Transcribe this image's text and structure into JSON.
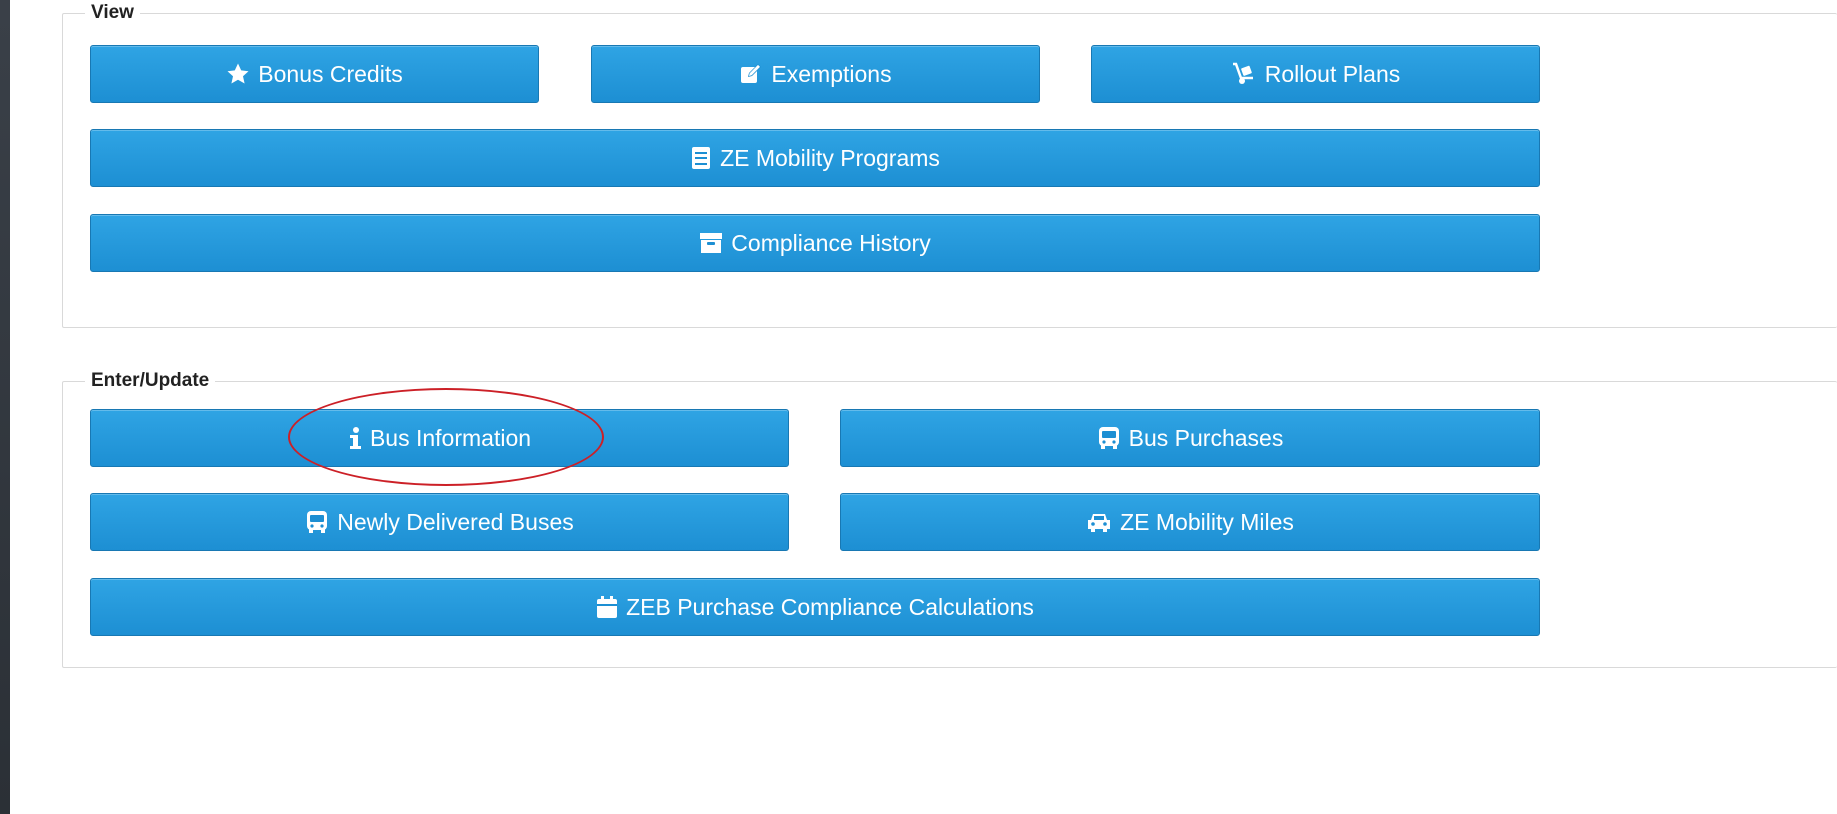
{
  "view": {
    "legend": "View",
    "buttons": {
      "bonus_credits": {
        "label": "Bonus Credits",
        "icon": "star-icon"
      },
      "exemptions": {
        "label": "Exemptions",
        "icon": "edit-icon"
      },
      "rollout_plans": {
        "label": "Rollout Plans",
        "icon": "dolly-icon"
      },
      "ze_mobility_programs": {
        "label": "ZE Mobility Programs",
        "icon": "book-icon"
      },
      "compliance_history": {
        "label": "Compliance History",
        "icon": "archive-icon"
      }
    }
  },
  "enter_update": {
    "legend": "Enter/Update",
    "buttons": {
      "bus_information": {
        "label": "Bus Information",
        "icon": "info-icon"
      },
      "bus_purchases": {
        "label": "Bus Purchases",
        "icon": "bus-icon"
      },
      "newly_delivered_buses": {
        "label": "Newly Delivered Buses",
        "icon": "bus-icon"
      },
      "ze_mobility_miles": {
        "label": "ZE Mobility Miles",
        "icon": "car-icon"
      },
      "zeb_purchase_compliance": {
        "label": "ZEB Purchase Compliance Calculations",
        "icon": "calendar-icon"
      }
    }
  },
  "colors": {
    "button": "#1d8fd3",
    "annotation": "#cc2027"
  }
}
